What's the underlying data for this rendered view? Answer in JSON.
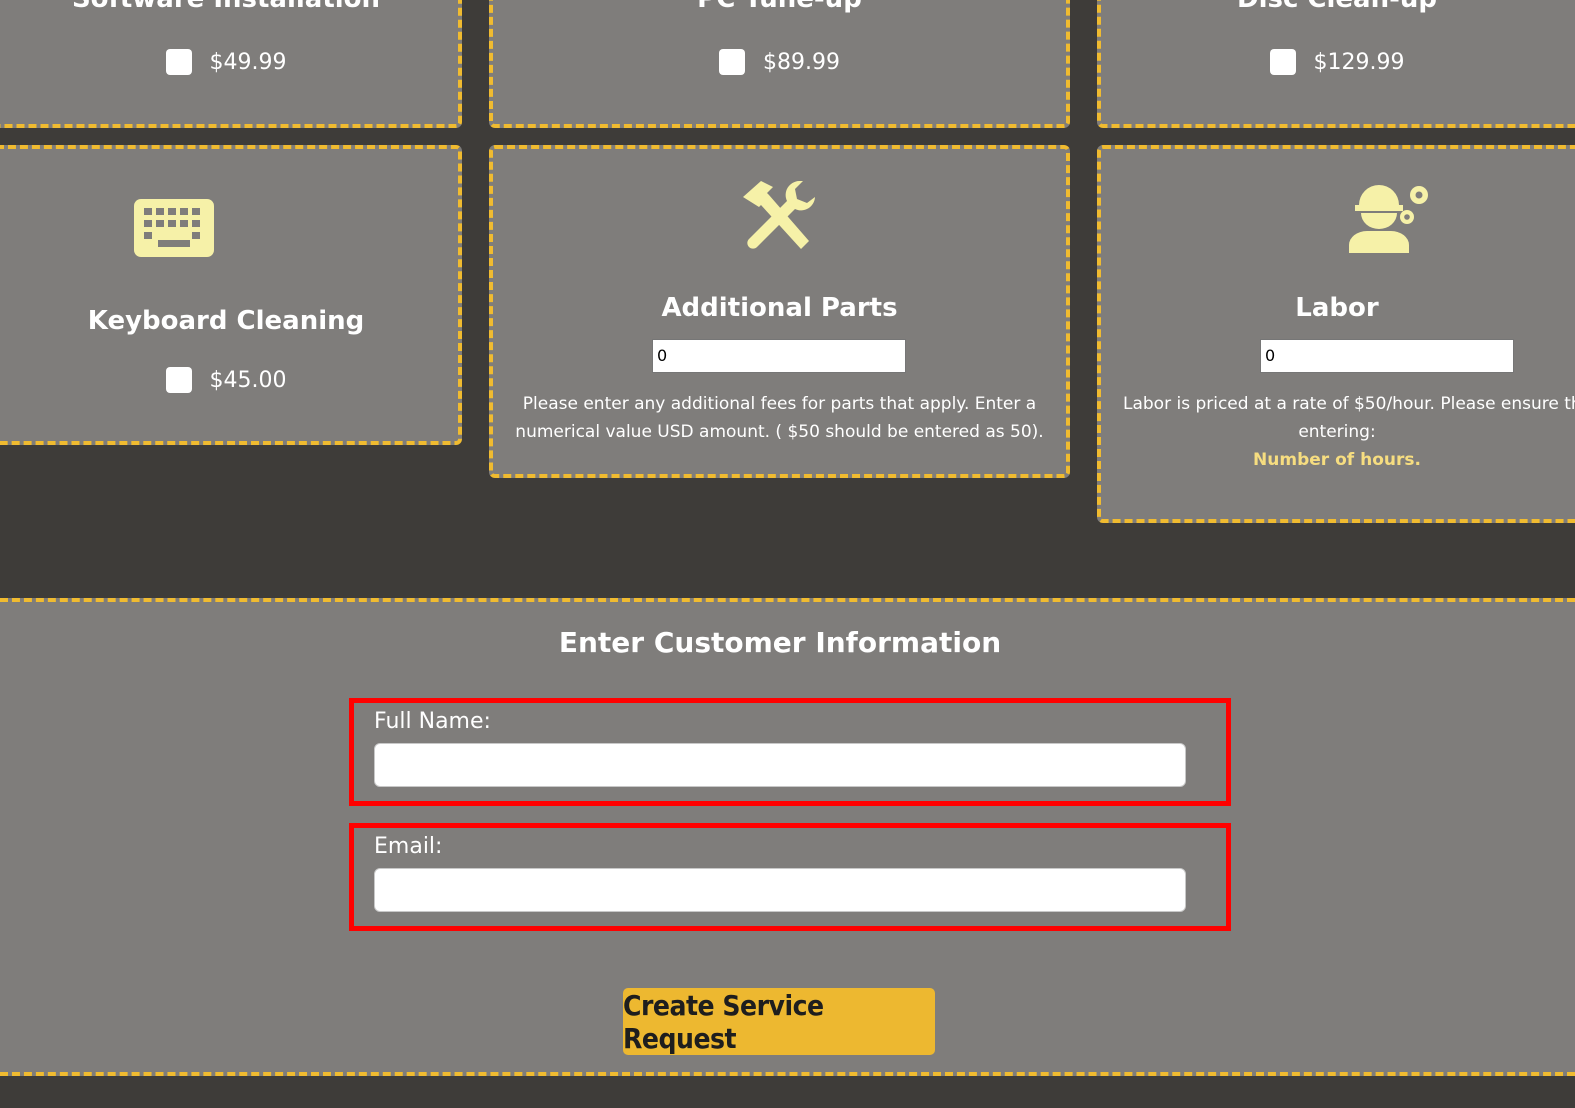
{
  "services_top": [
    {
      "title": "Software Installation",
      "price": "$49.99"
    },
    {
      "title": "PC Tune-up",
      "price": "$89.99"
    },
    {
      "title": "Disc Clean-up",
      "price": "$129.99"
    }
  ],
  "keyboard_card": {
    "title": "Keyboard Cleaning",
    "price": "$45.00",
    "icon": "keyboard-icon"
  },
  "parts_card": {
    "title": "Additional Parts",
    "value": "0",
    "icon": "tools-icon",
    "desc_line1": "Please enter any additional fees for parts that apply. Enter a",
    "desc_line2": "numerical value USD amount. ( $50 should be entered as 50)."
  },
  "labor_card": {
    "title": "Labor",
    "value": "0",
    "icon": "worker-gear-icon",
    "desc_line1": "Labor is priced at a rate of $50/hour. Please ensure th",
    "desc_line2": "entering:",
    "highlight": "Number of hours."
  },
  "customer": {
    "title": "Enter Customer Information",
    "full_name_label": "Full Name:",
    "full_name_value": "",
    "email_label": "Email:",
    "email_value": "",
    "submit_label": "Create Service Request"
  },
  "colors": {
    "accent": "#f0bb30",
    "card_bg": "#7f7d7b",
    "page_bg": "#3e3c39",
    "icon": "#f6f1a8",
    "highlight_border": "#ff0000"
  }
}
